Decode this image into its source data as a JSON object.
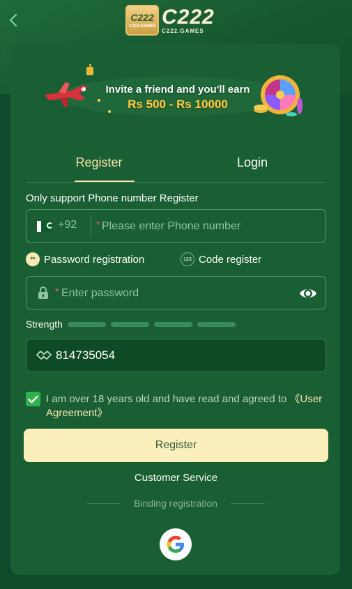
{
  "header": {
    "logo_badge": "C222",
    "logo_badge_sub": "C222.GAMES",
    "logo_text": "C222",
    "logo_subtext": "C222.GAMES"
  },
  "banner": {
    "line1": "Invite a friend and you'll earn",
    "line2": "Rs 500 - Rs 10000"
  },
  "tabs": {
    "register": "Register",
    "login": "Login"
  },
  "form": {
    "support_text": "Only support Phone number Register",
    "country_code": "+92",
    "phone_placeholder": "Please enter Phone number",
    "password_option": "Password registration",
    "code_option": "Code register",
    "code_icon_text": "123",
    "password_icon_text": "**",
    "password_placeholder": "Enter password",
    "strength_label": "Strength",
    "invite_code": "814735054",
    "agree_text": "I am over 18 years old and have read and agreed to ",
    "agree_link": "《User Agreement》",
    "register_button": "Register",
    "customer_service": "Customer Service",
    "binding_text": "Binding registration"
  },
  "colors": {
    "background": "#0f4a2a",
    "card": "#1a5e33",
    "accent": "#fbefbb",
    "checkbox": "#30b14d"
  }
}
